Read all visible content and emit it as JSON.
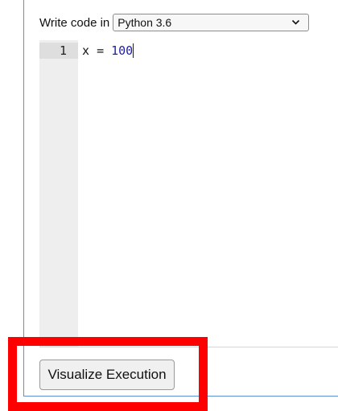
{
  "toolbar": {
    "label": "Write code in",
    "language_selected": "Python 3.6",
    "dropdown_icon": "chevron-down-icon"
  },
  "editor": {
    "line_number": "1",
    "code": {
      "variable": "x",
      "operator": "=",
      "value": "100"
    }
  },
  "actions": {
    "visualize_label": "Visualize Execution"
  },
  "colors": {
    "highlight": "#ff0000",
    "panel_border": "#5b8fd6",
    "number_literal": "#1f1faa"
  }
}
